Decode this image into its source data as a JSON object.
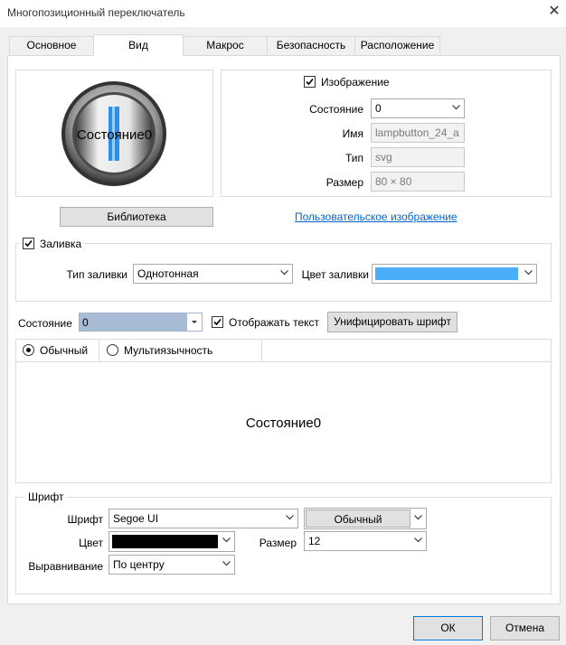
{
  "window": {
    "title": "Многопозиционный переключатель",
    "close_glyph": "✕"
  },
  "tabs": [
    {
      "label": "Основное"
    },
    {
      "label": "Вид"
    },
    {
      "label": "Макрос"
    },
    {
      "label": "Безопасность"
    },
    {
      "label": "Расположение"
    }
  ],
  "image": {
    "preview_text": "Состояние0",
    "checkbox_label": "Изображение",
    "state_label": "Состояние",
    "state_value": "0",
    "name_label": "Имя",
    "name_value": "lampbutton_24_a",
    "type_label": "Тип",
    "type_value": "svg",
    "size_label": "Размер",
    "size_value": "80 × 80",
    "library_button": "Библиотека",
    "custom_link": "Пользовательское изображение"
  },
  "fill": {
    "checkbox_label": "Заливка",
    "type_label": "Тип заливки",
    "type_value": "Однотонная",
    "color_label": "Цвет заливки",
    "color_value": "#4aaefa"
  },
  "state_row": {
    "label": "Состояние",
    "value": "0",
    "show_text_label": "Отображать текст",
    "unify_button": "Унифицировать шрифт"
  },
  "text_mode": {
    "normal_label": "Обычный",
    "multi_label": "Мультиязычность",
    "preview_text": "Состояние0"
  },
  "font": {
    "group_label": "Шрифт",
    "font_label": "Шрифт",
    "font_value": "Segoe UI",
    "style_value": "Обычный",
    "color_label": "Цвет",
    "color_value": "#000000",
    "size_label": "Размер",
    "size_value": "12",
    "align_label": "Выравнивание",
    "align_value": "По центру"
  },
  "footer": {
    "ok_button": "ОК",
    "cancel_button": "Отмена"
  },
  "colors": {
    "accent_link": "#0066cc",
    "state_combo_bg": "#a8bcd6"
  }
}
